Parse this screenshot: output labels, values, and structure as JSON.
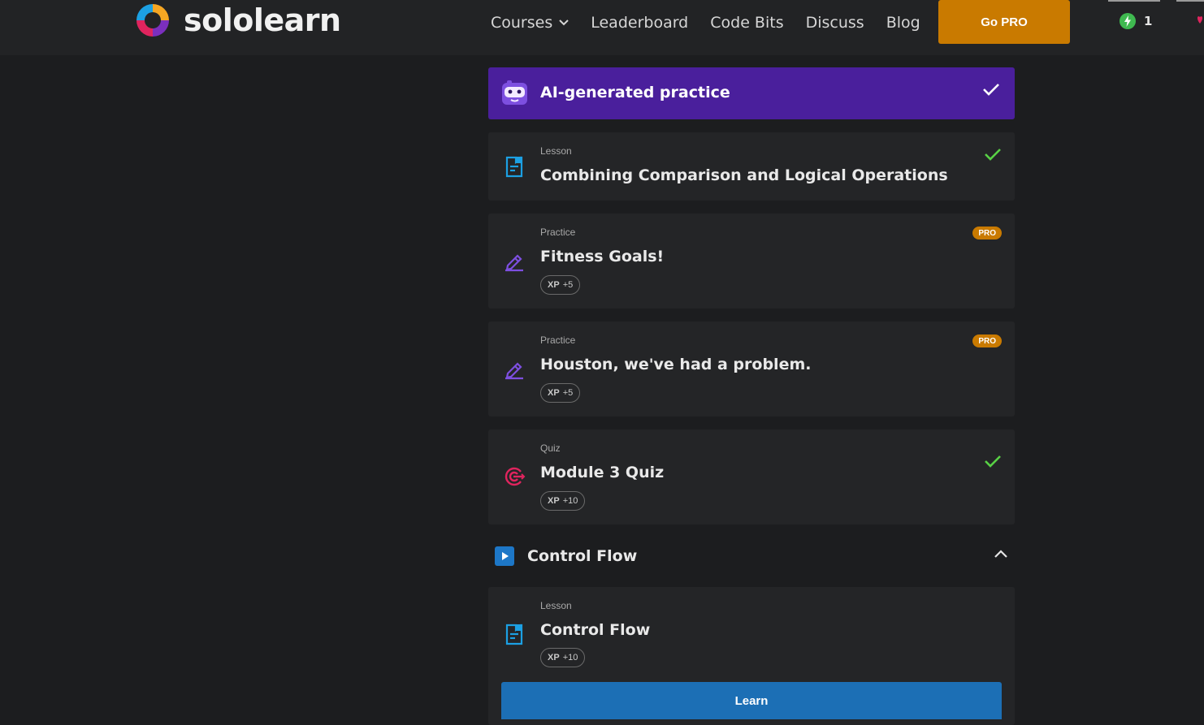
{
  "header": {
    "logo_text": "sololearn",
    "nav": [
      "Courses",
      "Leaderboard",
      "Code Bits",
      "Discuss",
      "Blog"
    ],
    "go_pro_label": "Go PRO",
    "streak_count": "1"
  },
  "ai_banner": {
    "title": "AI-generated practice"
  },
  "items": [
    {
      "type": "Lesson",
      "title": "Combining Comparison and Logical Operations",
      "completed": true
    },
    {
      "type": "Practice",
      "title": "Fitness Goals!",
      "xp_label": "XP",
      "xp_value": "+5",
      "badge": "PRO"
    },
    {
      "type": "Practice",
      "title": "Houston, we've had a problem.",
      "xp_label": "XP",
      "xp_value": "+5",
      "badge": "PRO"
    },
    {
      "type": "Quiz",
      "title": "Module 3 Quiz",
      "xp_label": "XP",
      "xp_value": "+10",
      "completed": true
    }
  ],
  "section": {
    "title": "Control Flow",
    "lesson": {
      "type": "Lesson",
      "title": "Control Flow",
      "xp_label": "XP",
      "xp_value": "+10"
    },
    "learn_label": "Learn"
  },
  "colors": {
    "brand_orange": "#c97a00",
    "ai_purple": "#4a1f9c",
    "learn_blue": "#1c6fb5",
    "check_green": "#58d145"
  }
}
